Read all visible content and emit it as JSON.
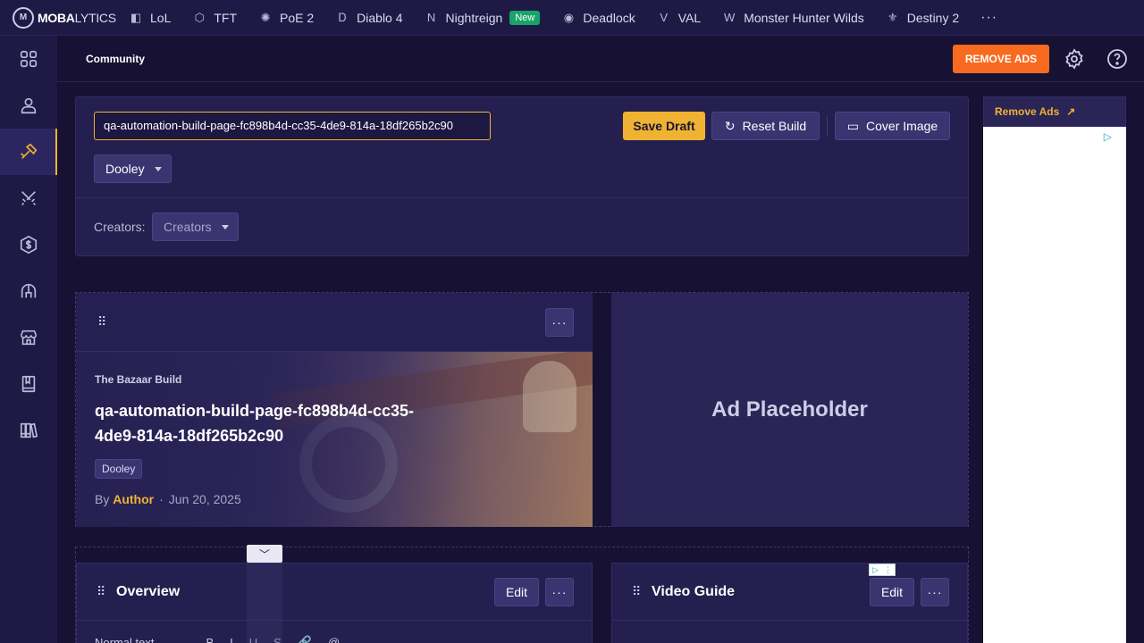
{
  "logo": {
    "bold": "MOBA",
    "light": "LYTICS",
    "mark": "M"
  },
  "games": [
    {
      "label": "LoL",
      "icon": "lol-icon",
      "glyph": "◧"
    },
    {
      "label": "TFT",
      "icon": "tft-icon",
      "glyph": "⬡"
    },
    {
      "label": "PoE 2",
      "icon": "poe2-icon",
      "glyph": "✺"
    },
    {
      "label": "Diablo 4",
      "icon": "diablo-icon",
      "glyph": "Ꭰ"
    },
    {
      "label": "Nightreign",
      "icon": "nightreign-icon",
      "glyph": "N",
      "badge": "New"
    },
    {
      "label": "Deadlock",
      "icon": "deadlock-icon",
      "glyph": "◉"
    },
    {
      "label": "VAL",
      "icon": "valorant-icon",
      "glyph": "V"
    },
    {
      "label": "Monster Hunter Wilds",
      "icon": "mhw-icon",
      "glyph": "W"
    },
    {
      "label": "Destiny 2",
      "icon": "destiny-icon",
      "glyph": "⚜"
    }
  ],
  "more": "···",
  "header": {
    "breadcrumb": "Community",
    "remove_ads": "REMOVE ADS"
  },
  "editor": {
    "slug": "qa-automation-build-page-fc898b4d-cc35-4de9-814a-18df265b2c90",
    "save_draft": "Save Draft",
    "reset_build": "Reset Build",
    "cover_image": "Cover Image",
    "hero_select": "Dooley",
    "creators_label": "Creators:",
    "creators_select": "Creators"
  },
  "hero": {
    "subtitle": "The Bazaar Build",
    "title": "qa-automation-build-page-fc898b4d-cc35-4de9-814a-18df265b2c90",
    "tag": "Dooley",
    "by": "By",
    "author": "Author",
    "separator": "·",
    "date": "Jun 20, 2025",
    "menu": "···"
  },
  "ad_placeholder": "Ad Placeholder",
  "overview": {
    "title": "Overview",
    "edit": "Edit",
    "menu": "···",
    "toolbar": [
      "Normal text",
      "B",
      "I",
      "U",
      "S",
      "🔗",
      "@"
    ]
  },
  "video_guide": {
    "title": "Video Guide",
    "edit": "Edit",
    "menu": "···"
  },
  "right_ad": {
    "label": "Remove Ads",
    "ext_icon": "↗",
    "adchoice": "▷"
  },
  "colors": {
    "accent": "#f0b232",
    "remove_ads": "#f76a1f",
    "nav_bg": "#1f1a45",
    "page_bg": "#171233"
  }
}
